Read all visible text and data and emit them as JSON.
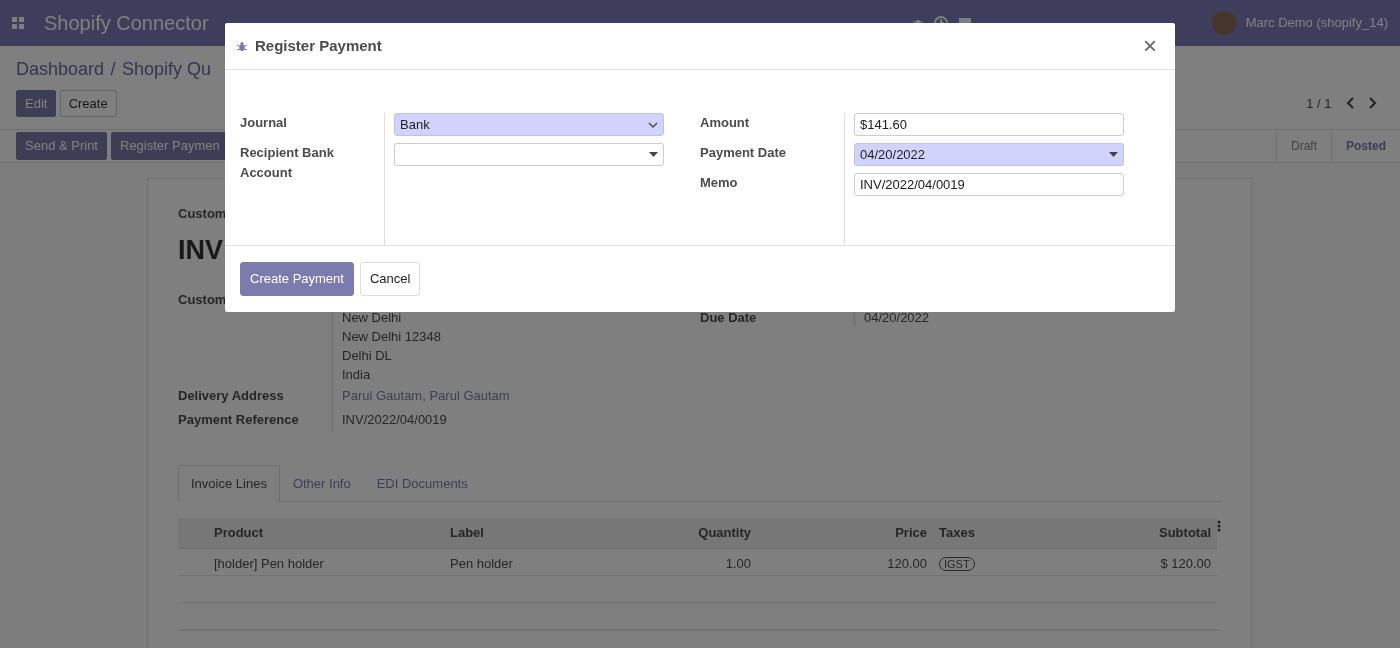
{
  "navbar": {
    "app_name": "Shopify Connector",
    "user": "Marc Demo (shopify_14)"
  },
  "breadcrumb": [
    "Dashboard",
    "Shopify Qu"
  ],
  "breadcrumb_separator": "/",
  "actions": [
    {
      "label": "Edit",
      "kind": "primary"
    },
    {
      "label": "Create",
      "kind": "secondary"
    }
  ],
  "pager": "1 / 1",
  "header_buttons": [
    "Send & Print",
    "Register Paymen"
  ],
  "statusbar": [
    {
      "label": "Draft",
      "selected": false
    },
    {
      "label": "Posted",
      "selected": true
    }
  ],
  "sheet": {
    "type_label": "Custom",
    "name": "INV",
    "customer_label": "Custom",
    "address": [
      "New Delhi",
      "New Delhi 12348",
      "Delhi DL",
      "India"
    ],
    "fields": [
      {
        "label": "Delivery Address",
        "value": "Parul Gautam, Parul Gautam",
        "kind": "link"
      },
      {
        "label": "Payment Reference",
        "value": "INV/2022/04/0019",
        "kind": "text"
      }
    ],
    "right_fields": [
      {
        "label": "Due Date",
        "value": "04/20/2022"
      }
    ]
  },
  "tabs": [
    {
      "label": "Invoice Lines",
      "selected": true
    },
    {
      "label": "Other Info",
      "selected": false
    },
    {
      "label": "EDI Documents",
      "selected": false
    }
  ],
  "table": {
    "columns": [
      {
        "label": "Product",
        "kind": "text"
      },
      {
        "label": "Label",
        "kind": "text"
      },
      {
        "label": "Quantity",
        "kind": "number"
      },
      {
        "label": "Price",
        "kind": "number"
      },
      {
        "label": "Taxes",
        "kind": "tags"
      },
      {
        "label": "Subtotal",
        "kind": "number"
      }
    ],
    "rows": [
      [
        "[holder] Pen holder",
        "Pen holder",
        "1.00",
        "120.00",
        "IGST",
        "$ 120.00"
      ]
    ]
  },
  "modal": {
    "title": "Register Payment",
    "close": "×",
    "left_fields": [
      {
        "label": "Journal",
        "kind": "select",
        "value": "Bank",
        "required": true
      },
      {
        "label": "Recipient Bank Account",
        "kind": "dropdown",
        "required": false
      }
    ],
    "right_fields": [
      {
        "label": "Amount",
        "kind": "input",
        "value": "$141.60",
        "required": false
      },
      {
        "label": "Payment Date",
        "kind": "dropdown",
        "value": "04/20/2022",
        "required": true
      },
      {
        "label": "Memo",
        "kind": "input",
        "value": "INV/2022/04/0019",
        "required": false
      }
    ],
    "buttons": [
      {
        "label": "Create Payment",
        "kind": "primary"
      },
      {
        "label": "Cancel",
        "kind": "secondary"
      }
    ]
  }
}
